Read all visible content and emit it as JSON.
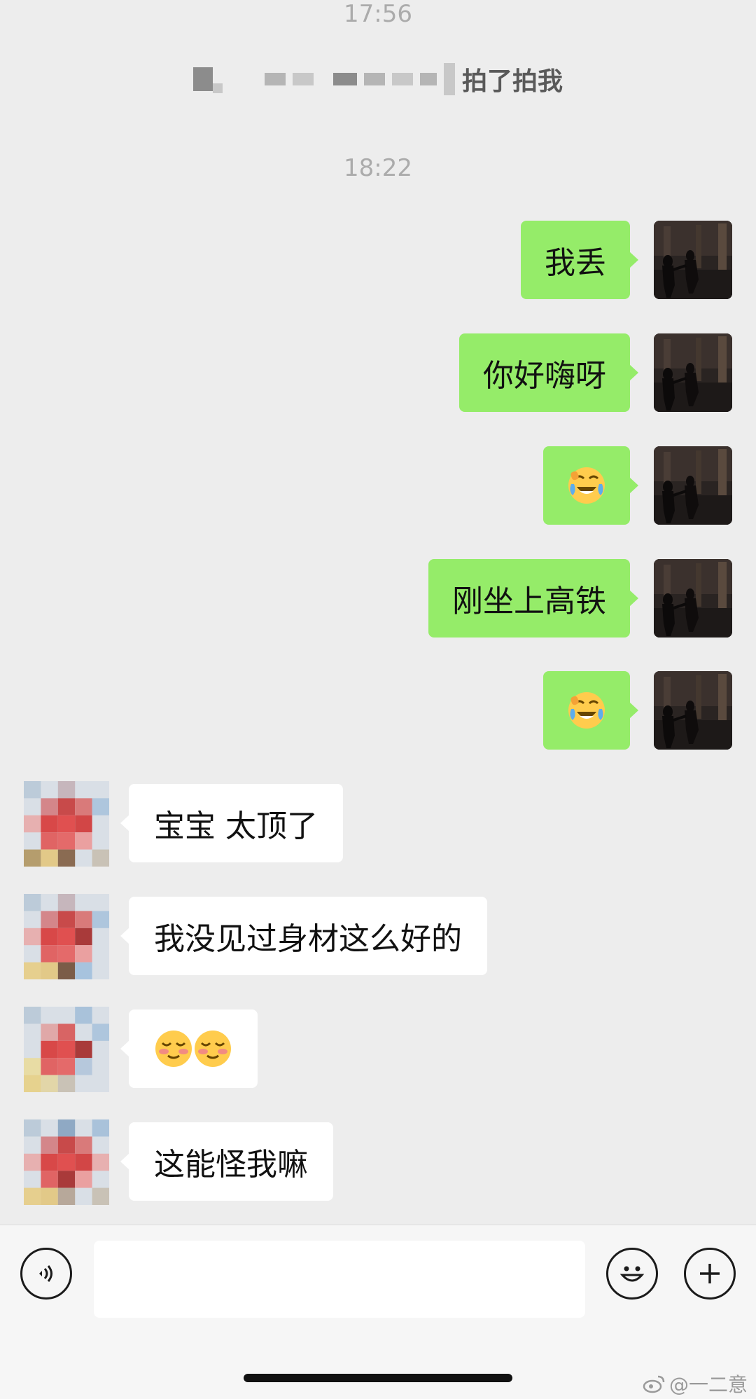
{
  "chat": {
    "time_1": "17:56",
    "pat_text": "拍了拍我",
    "time_2": "18:22",
    "outgoing": [
      {
        "text": "我丢"
      },
      {
        "text": "你好嗨呀"
      },
      {
        "emoji": "face-with-tears-of-joy-emoji"
      },
      {
        "text": "刚坐上高铁"
      },
      {
        "emoji": "face-with-tears-of-joy-emoji"
      }
    ],
    "incoming": [
      {
        "text": "宝宝 太顶了"
      },
      {
        "text": "我没见过身材这么好的"
      },
      {
        "emoji": "blushing-smile-emoji-x2"
      },
      {
        "text": "这能怪我嘛"
      }
    ]
  },
  "input_bar": {
    "placeholder": "",
    "icons": [
      "voice-icon",
      "smiley-icon",
      "plus-icon"
    ]
  },
  "watermark": "@一二意",
  "colors": {
    "background": "#ededed",
    "outgoing_bubble": "#95ec69",
    "incoming_bubble": "#ffffff",
    "timestamp": "#ababab"
  }
}
